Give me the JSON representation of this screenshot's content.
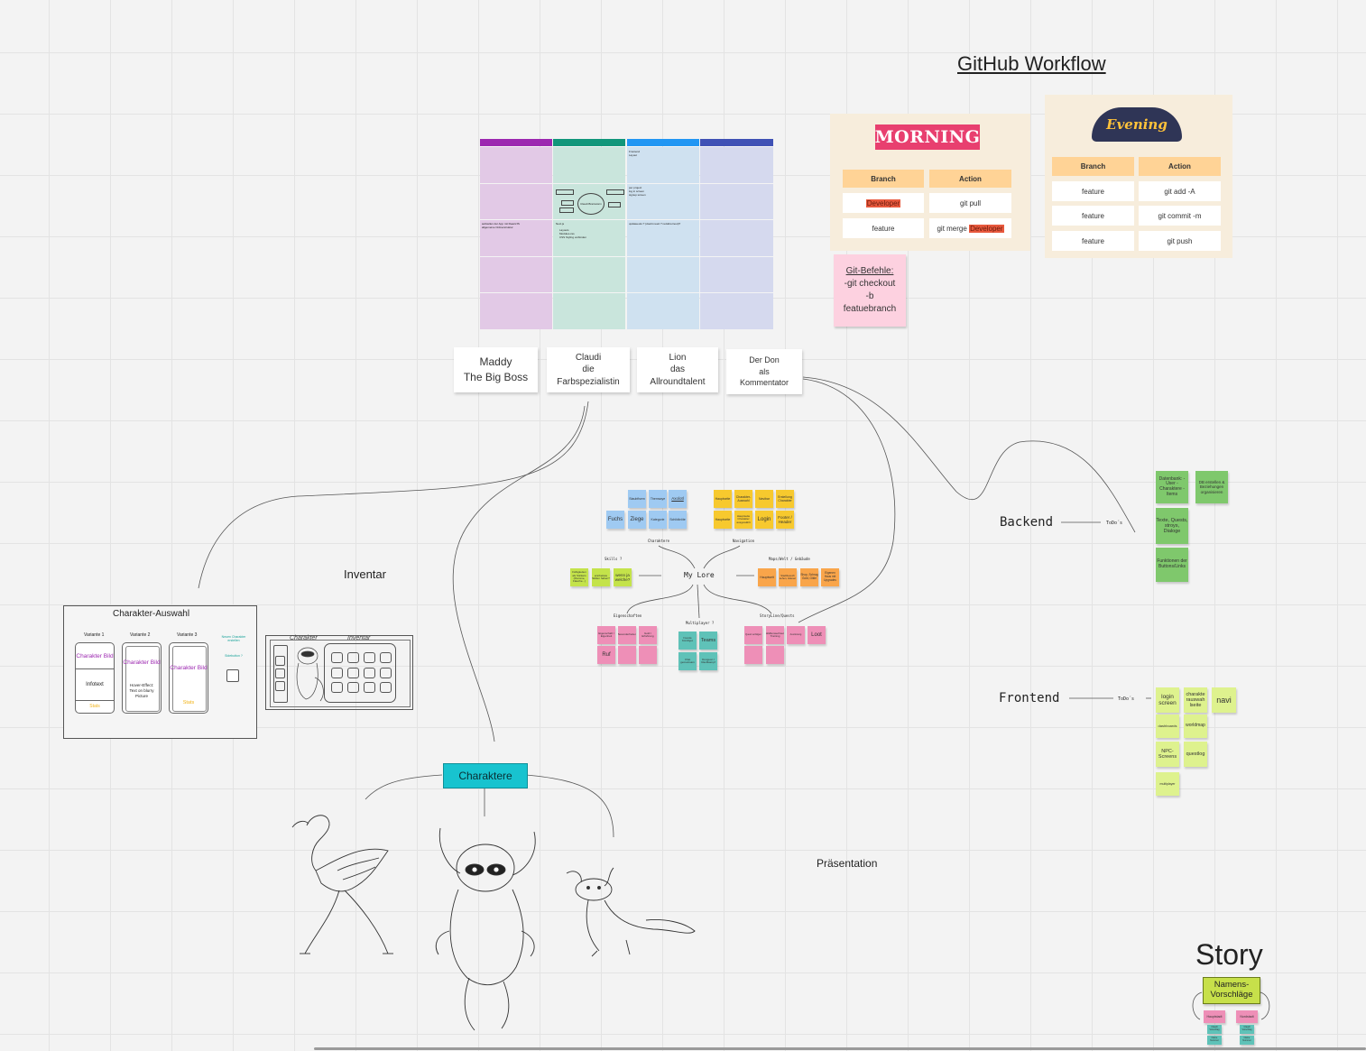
{
  "workflow": {
    "title": "GitHub Workflow",
    "morning": {
      "badge": "MORNING",
      "headers": [
        "Branch",
        "Action"
      ],
      "rows": [
        {
          "branch": "Developer",
          "action": "git pull",
          "branch_highlight": true
        },
        {
          "branch": "feature",
          "action_prefix": "git merge",
          "action_highlight": "Developer"
        }
      ]
    },
    "evening": {
      "badge": "Evening",
      "headers": [
        "Branch",
        "Action"
      ],
      "rows": [
        {
          "branch": "feature",
          "action": "git add -A"
        },
        {
          "branch": "feature",
          "action": "git commit -m"
        },
        {
          "branch": "feature",
          "action": "git push"
        }
      ]
    },
    "git_note": {
      "title": "Git-Befehle:",
      "lines": [
        "-git checkout",
        "-b",
        "featuebranch"
      ]
    }
  },
  "kanban": {
    "column_colors": [
      "#9c27b0",
      "#11967a",
      "#2196f3",
      "#3f51b5"
    ],
    "body_colors": [
      "#e2c9e6",
      "#c9e5dc",
      "#cfe1f0",
      "#d5d9ee"
    ],
    "tiny_texts": {
      "c3_top": "Frontend",
      "c3_top2": "Layout",
      "c3_r2a": "per project",
      "c3_r2b": "log in screen",
      "c3_r2c": "signup screen",
      "c2_bubble": "Claudi Brainstorm",
      "c1_r3a": "aufstellen der App mit React/JS",
      "c1_r3b": "allgemeine Ordnerstruktur",
      "c2_r3a": "Next.js",
      "c2_r3b": "Layouts",
      "c2_r3c": "Modules.css",
      "c2_r3d": "CSS Styling verbinden",
      "c3_r3": "updateeuts ? (doubt react ? redubtornout)?"
    }
  },
  "team": [
    {
      "line1": "Maddy",
      "line2": "The Big  Boss",
      "line3": ""
    },
    {
      "line1": "Claudi",
      "line2": "die",
      "line3": "Farbspezialistin"
    },
    {
      "line1": "Lion",
      "line2": "das",
      "line3": "Allroundtalent"
    },
    {
      "line1": "Der Don",
      "line2": "als",
      "line3": "Kommentator"
    }
  ],
  "mindmap": {
    "center": "My Lore",
    "branches": {
      "charaktere": "Charaktere",
      "navigation": "Navigation",
      "skills": "Skills ?",
      "maps": "Maps/Welt / Gebäude",
      "eigenschaften": "Eigenschaften",
      "multiplayer": "Multiplayer ?",
      "story": "StoryLine/Quests"
    },
    "charaktere_notes": [
      "Staubfisem",
      "Themsaye",
      "Axolotl",
      "Fuchs",
      "Ziege",
      "Kategorie",
      "Schildkröte"
    ],
    "navigation_notes": [
      "Hauptseite",
      "Charakter-Auswahl",
      "Navibar",
      "Erstellung Charakter",
      "Hauptseite",
      "Hauptseite Charakter ausgewählt",
      "Login",
      "Footer / Header"
    ],
    "skills_notes": [
      "Fähigkeiten als Stickers (Flamme, Flasche...)",
      "erarbeitete Skillen haben?",
      "wenn ja welche?"
    ],
    "maps_notes": [
      "Hauptwelt",
      "Stadtbesuch sehen, Häuser",
      "Shop, Schrag Gold, Gilde",
      "Eigenen Haus mit Upgrades"
    ],
    "eigen_notes": [
      "Eigenschaft / Eigenheit",
      "Besonderheiten",
      "Gold / Erfahrung",
      "Ruf"
    ],
    "multi_notes": [
      "Freunde hinzufügen",
      "Teams",
      "Chat gemeinsam",
      "Dungeon / Raubkampf"
    ],
    "story_notes": [
      "Quest verfolgen",
      "Waffenwechsel, Training",
      "Ausrüstung",
      "Loot"
    ]
  },
  "backend": {
    "title": "Backend",
    "todo": "ToDo´s",
    "notes": [
      "Datenbank: -User -Charaktere -Items",
      "DB erstellen & Beziehungen organisieren",
      "Texte, Quests, stroys, Dialoge",
      "Funktionen der Buttons/Links"
    ]
  },
  "frontend": {
    "title": "Frontend",
    "todo": "ToDo´s",
    "notes": [
      "login screen",
      "charakte rauswah lseite",
      "navi",
      "dashboards",
      "worldmap",
      "NPC-Screens",
      "questlog",
      "multiplayer"
    ]
  },
  "inventar": {
    "title": "Inventar",
    "sketch_left": "Charakter",
    "sketch_right": "Inventar"
  },
  "auswahl": {
    "title": "Charakter-Auswahl",
    "variants": [
      "Variante 1",
      "Variante 2",
      "Variante 3"
    ],
    "bild": "Charakter Bild",
    "infotext": "Infotext",
    "stats": "Stats",
    "hover": "Hover-Effect: Text on blurry Picture",
    "side_note": "Neuen Charakter erstellen",
    "side_note2": "Sidebutton ?"
  },
  "charaktere_node": "Charaktere",
  "praesentation": "Präsentation",
  "story": {
    "title": "Story",
    "namen": "Namens-Vorschläge",
    "sub_left": "Hauptstadt",
    "sub_right": "Nordstadt",
    "teal_left": [
      "Claudi Vorschlag",
      "Name Nummer"
    ],
    "teal_right": [
      "Claudi Vorschlag",
      "Name Nummer"
    ]
  }
}
